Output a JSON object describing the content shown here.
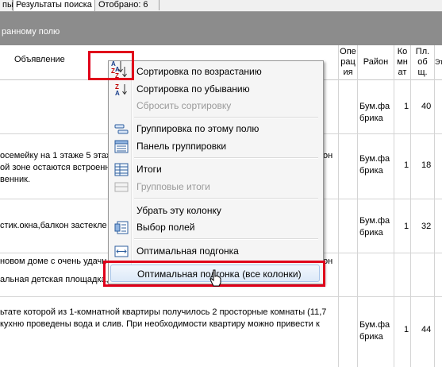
{
  "tabs": [
    {
      "label": "пы"
    },
    {
      "label": "Результаты поиска"
    },
    {
      "label": "Отобрано: 6"
    }
  ],
  "group_band_hint": "ранному полю",
  "columns": {
    "ad": "Объявление",
    "operation": "Опе рация",
    "district": "Район",
    "rooms": "Ко мн ат",
    "area": "Пл. об щ.",
    "extra": "Эт"
  },
  "rows": [
    {
      "text": [
        "",
        "",
        ""
      ],
      "district": "Бум.фа брика",
      "rooms": "1",
      "area": "40"
    },
    {
      "text": [
        "осемейку на 1 этаже 5 этаж",
        "ой зоне остаются встроенн",
        "венник."
      ],
      "tail": "он",
      "district": "Бум.фа брика",
      "rooms": "1",
      "area": "18"
    },
    {
      "text": [
        "стик.окна,балкон застекле"
      ],
      "district": "Бум.фа брика",
      "rooms": "1",
      "area": "32"
    },
    {
      "text": [
        "новом доме с очень удачн",
        "альная детская площадка, рядом детский сад, школа, магазины.",
        ""
      ],
      "tail": "он",
      "district": "",
      "rooms": "",
      "area": ""
    },
    {
      "text": [
        "ьтате которой из 1-комнатной квартиры получилось 2 просторные комнаты (11,7",
        "кухню проведены вода и слив. При необходимости квартиру можно привести к",
        ""
      ],
      "district": "Бум.фа брика",
      "rooms": "1",
      "area": "44"
    }
  ],
  "menu": {
    "items": [
      {
        "label": "Сортировка по возрастанию",
        "icon": "sort-ascending-icon",
        "enabled": true
      },
      {
        "label": "Сортировка по убыванию",
        "icon": "sort-descending-icon",
        "enabled": true
      },
      {
        "label": "Сбросить сортировку",
        "icon": "",
        "enabled": false
      },
      {
        "label": "Группировка по этому полю",
        "icon": "group-by-field-icon",
        "enabled": true
      },
      {
        "label": "Панель группировки",
        "icon": "group-panel-icon",
        "enabled": true
      },
      {
        "label": "Итоги",
        "icon": "totals-icon",
        "enabled": true
      },
      {
        "label": "Групповые итоги",
        "icon": "group-totals-icon",
        "enabled": false
      },
      {
        "label": "Убрать эту колонку",
        "icon": "",
        "enabled": true
      },
      {
        "label": "Выбор полей",
        "icon": "field-chooser-icon",
        "enabled": true
      },
      {
        "label": "Оптимальная подгонка",
        "icon": "best-fit-icon",
        "enabled": true
      },
      {
        "label": "Оптимальная подгонка (все колонки)",
        "icon": "",
        "enabled": true
      }
    ],
    "hovered_item": "Оптимальная подгонка (все колонки)"
  },
  "colors": {
    "highlight_box": "#e0001a",
    "group_band": "#8c8c8c"
  }
}
